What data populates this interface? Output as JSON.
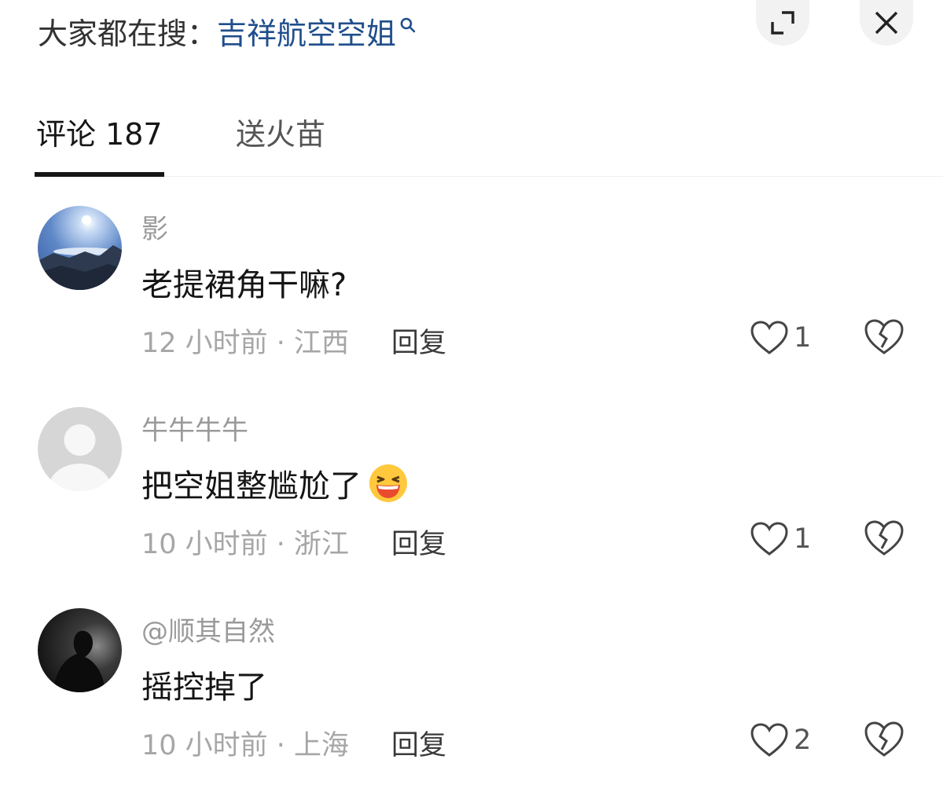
{
  "header": {
    "search_prefix": "大家都在搜：",
    "search_keyword": "吉祥航空空姐",
    "expand_icon": "expand-icon",
    "close_icon": "close-icon"
  },
  "tabs": [
    {
      "label": "评论 187",
      "active": true
    },
    {
      "label": "送火苗",
      "active": false
    }
  ],
  "comments": [
    {
      "author": "影",
      "text": "老提裙角干嘛?",
      "meta": "12 小时前 · 江西",
      "reply_label": "回复",
      "likes": "1",
      "avatar": "sky-landscape-avatar"
    },
    {
      "author": "牛牛牛牛",
      "text": "把空姐整尴尬了",
      "emoji": "laughing-emoji",
      "meta": "10 小时前 · 浙江",
      "reply_label": "回复",
      "likes": "1",
      "avatar": "default-avatar"
    },
    {
      "author": "@顺其自然",
      "text": "摇控掉了",
      "meta": "10 小时前 · 上海",
      "reply_label": "回复",
      "likes": "2",
      "avatar": "dark-portrait-avatar"
    }
  ],
  "colors": {
    "keyword": "#1f4e8c",
    "muted": "#a6a6a6",
    "text": "#141414"
  }
}
